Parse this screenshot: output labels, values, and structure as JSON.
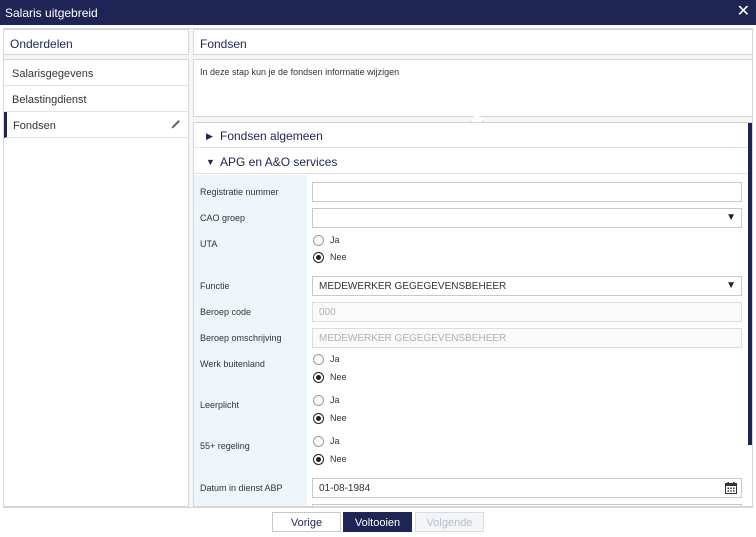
{
  "window": {
    "title": "Salaris uitgebreid",
    "close_label": "✕"
  },
  "left": {
    "header": "Onderdelen",
    "items": [
      {
        "label": "Salarisgegevens"
      },
      {
        "label": "Belastingdienst"
      },
      {
        "label": "Fondsen"
      }
    ]
  },
  "right": {
    "header": "Fondsen",
    "intro": "In deze stap kun je de fondsen informatie wijzigen",
    "sections": [
      {
        "label": "Fondsen algemeen",
        "caret": "▶"
      },
      {
        "label": "APG en A&O services",
        "caret": "▼"
      }
    ]
  },
  "form": {
    "registratie_label": "Registratie nummer",
    "registratie_value": "",
    "cao_label": "CAO groep",
    "cao_value": "",
    "uta_label": "UTA",
    "uta_options": [
      "Ja",
      "Nee"
    ],
    "functie_label": "Functie",
    "functie_value": "MEDEWERKER GEGEGEVENSBEHEER",
    "beroep_code_label": "Beroep code",
    "beroep_code_value": "000",
    "beroep_omschrijving_label": "Beroep omschrijving",
    "beroep_omschrijving_value": "MEDEWERKER GEGEGEVENSBEHEER",
    "werk_buitenland_label": "Werk buitenland",
    "werk_buitenland_options": [
      "Ja",
      "Nee"
    ],
    "leerplicht_label": "Leerplicht",
    "leerplicht_options": [
      "Ja",
      "Nee"
    ],
    "regeling55_label": "55+ regeling",
    "regeling55_options": [
      "Ja",
      "Nee"
    ],
    "datum_label": "Datum in dienst ABP",
    "datum_value": "01-08-1984",
    "selected": "Nee"
  },
  "footer": {
    "prev": "Vorige",
    "finish": "Voltooien",
    "next": "Volgende"
  },
  "colors": {
    "navy": "#1e2454",
    "label_bg": "#eef5fb"
  },
  "icons": [
    "close-icon",
    "pencil-icon",
    "caret-right-icon",
    "caret-down-icon",
    "dropdown-icon",
    "calendar-icon"
  ]
}
